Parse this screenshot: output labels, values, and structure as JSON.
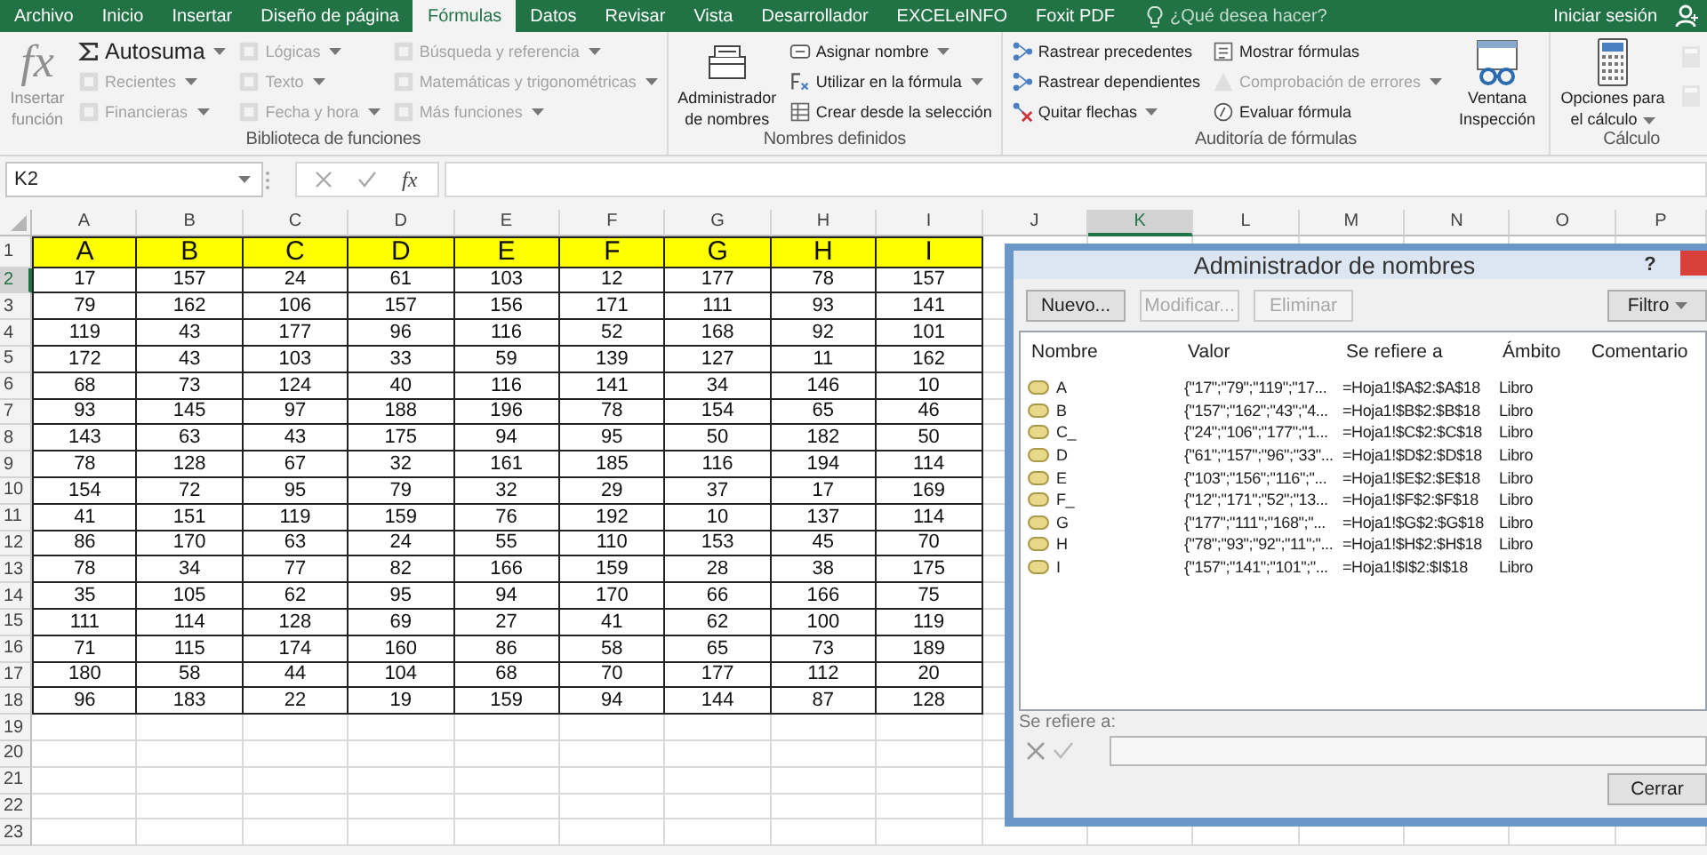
{
  "tabs": [
    {
      "label": "Archivo",
      "selected": false
    },
    {
      "label": "Inicio",
      "selected": false
    },
    {
      "label": "Insertar",
      "selected": false
    },
    {
      "label": "Diseño de página",
      "selected": false
    },
    {
      "label": "Fórmulas",
      "selected": true
    },
    {
      "label": "Datos",
      "selected": false
    },
    {
      "label": "Revisar",
      "selected": false
    },
    {
      "label": "Vista",
      "selected": false
    },
    {
      "label": "Desarrollador",
      "selected": false
    },
    {
      "label": "EXCELeINFO",
      "selected": false
    },
    {
      "label": "Foxit PDF",
      "selected": false
    }
  ],
  "tell_me": {
    "placeholder": "¿Qué desea hacer?"
  },
  "account": {
    "label": "Iniciar sesión"
  },
  "ribbon": {
    "groups": [
      {
        "title": "Biblioteca de funciones",
        "blocks": [
          {
            "kind": "big",
            "label": "Insertar función",
            "glyph": "fx",
            "disabled": true,
            "dropdown": false
          },
          {
            "kind": "column",
            "items": [
              {
                "label": "Autosuma",
                "disabled": false,
                "dropdown": true
              },
              {
                "label": "Recientes",
                "disabled": true,
                "dropdown": true
              },
              {
                "label": "Financieras",
                "disabled": true,
                "dropdown": true
              }
            ]
          },
          {
            "kind": "column",
            "items": [
              {
                "label": "Lógicas",
                "disabled": true,
                "dropdown": true
              },
              {
                "label": "Texto",
                "disabled": true,
                "dropdown": true
              },
              {
                "label": "Fecha y hora",
                "disabled": true,
                "dropdown": true
              }
            ]
          },
          {
            "kind": "column",
            "items": [
              {
                "label": "Búsqueda y referencia",
                "disabled": true,
                "dropdown": true
              },
              {
                "label": "Matemáticas y trigonométricas",
                "disabled": true,
                "dropdown": true
              },
              {
                "label": "Más funciones",
                "disabled": true,
                "dropdown": true
              }
            ]
          }
        ]
      },
      {
        "title": "Nombres definidos",
        "blocks": [
          {
            "kind": "big",
            "label": "Administrador de nombres",
            "disabled": false,
            "dropdown": false
          },
          {
            "kind": "column",
            "items": [
              {
                "label": "Asignar nombre",
                "disabled": false,
                "dropdown": true
              },
              {
                "label": "Utilizar en la fórmula",
                "disabled": false,
                "dropdown": true
              },
              {
                "label": "Crear desde la selección",
                "disabled": false,
                "dropdown": false
              }
            ]
          }
        ]
      },
      {
        "title": "Auditoría de fórmulas",
        "blocks": [
          {
            "kind": "column",
            "items": [
              {
                "label": "Rastrear precedentes",
                "disabled": false,
                "dropdown": false
              },
              {
                "label": "Rastrear dependientes",
                "disabled": false,
                "dropdown": false
              },
              {
                "label": "Quitar flechas",
                "disabled": false,
                "dropdown": true
              }
            ]
          },
          {
            "kind": "column",
            "items": [
              {
                "label": "Mostrar fórmulas",
                "disabled": false,
                "dropdown": false
              },
              {
                "label": "Comprobación de errores",
                "disabled": true,
                "dropdown": true
              },
              {
                "label": "Evaluar fórmula",
                "disabled": false,
                "dropdown": false
              }
            ]
          },
          {
            "kind": "big",
            "label": "Ventana Inspección",
            "disabled": false,
            "dropdown": false
          }
        ]
      },
      {
        "title": "Cálculo",
        "blocks": [
          {
            "kind": "big",
            "label": "Opciones para el cálculo",
            "disabled": false,
            "dropdown": true
          },
          {
            "kind": "icon_stack",
            "items": [
              {
                "disabled": true
              },
              {
                "disabled": true
              }
            ]
          }
        ]
      }
    ]
  },
  "formula_bar": {
    "name_box": "K2",
    "function_glyph": "fx"
  },
  "sheet": {
    "columns": [
      {
        "label": "A",
        "selected": false
      },
      {
        "label": "B",
        "selected": false
      },
      {
        "label": "C",
        "selected": false
      },
      {
        "label": "D",
        "selected": false
      },
      {
        "label": "E",
        "selected": false
      },
      {
        "label": "F",
        "selected": false
      },
      {
        "label": "G",
        "selected": false
      },
      {
        "label": "H",
        "selected": false
      },
      {
        "label": "I",
        "selected": false
      },
      {
        "label": "J",
        "selected": false
      },
      {
        "label": "K",
        "selected": true
      },
      {
        "label": "L",
        "selected": false
      },
      {
        "label": "M",
        "selected": false
      },
      {
        "label": "N",
        "selected": false
      },
      {
        "label": "O",
        "selected": false
      },
      {
        "label": "P",
        "selected": false
      }
    ],
    "rows": [
      {
        "number": "1",
        "selected": false,
        "kind": "header",
        "cells": [
          "A",
          "B",
          "C",
          "D",
          "E",
          "F",
          "G",
          "H",
          "I"
        ]
      },
      {
        "number": "2",
        "selected": true,
        "kind": "data",
        "cells": [
          "17",
          "157",
          "24",
          "61",
          "103",
          "12",
          "177",
          "78",
          "157"
        ]
      },
      {
        "number": "3",
        "selected": false,
        "kind": "data",
        "cells": [
          "79",
          "162",
          "106",
          "157",
          "156",
          "171",
          "111",
          "93",
          "141"
        ]
      },
      {
        "number": "4",
        "selected": false,
        "kind": "data",
        "cells": [
          "119",
          "43",
          "177",
          "96",
          "116",
          "52",
          "168",
          "92",
          "101"
        ]
      },
      {
        "number": "5",
        "selected": false,
        "kind": "data",
        "cells": [
          "172",
          "43",
          "103",
          "33",
          "59",
          "139",
          "127",
          "11",
          "162"
        ]
      },
      {
        "number": "6",
        "selected": false,
        "kind": "data",
        "cells": [
          "68",
          "73",
          "124",
          "40",
          "116",
          "141",
          "34",
          "146",
          "10"
        ]
      },
      {
        "number": "7",
        "selected": false,
        "kind": "data",
        "cells": [
          "93",
          "145",
          "97",
          "188",
          "196",
          "78",
          "154",
          "65",
          "46"
        ]
      },
      {
        "number": "8",
        "selected": false,
        "kind": "data",
        "cells": [
          "143",
          "63",
          "43",
          "175",
          "94",
          "95",
          "50",
          "182",
          "50"
        ]
      },
      {
        "number": "9",
        "selected": false,
        "kind": "data",
        "cells": [
          "78",
          "128",
          "67",
          "32",
          "161",
          "185",
          "116",
          "194",
          "114"
        ]
      },
      {
        "number": "10",
        "selected": false,
        "kind": "data",
        "cells": [
          "154",
          "72",
          "95",
          "79",
          "32",
          "29",
          "37",
          "17",
          "169"
        ]
      },
      {
        "number": "11",
        "selected": false,
        "kind": "data",
        "cells": [
          "41",
          "151",
          "119",
          "159",
          "76",
          "192",
          "10",
          "137",
          "114"
        ]
      },
      {
        "number": "12",
        "selected": false,
        "kind": "data",
        "cells": [
          "86",
          "170",
          "63",
          "24",
          "55",
          "110",
          "153",
          "45",
          "70"
        ]
      },
      {
        "number": "13",
        "selected": false,
        "kind": "data",
        "cells": [
          "78",
          "34",
          "77",
          "82",
          "166",
          "159",
          "28",
          "38",
          "175"
        ]
      },
      {
        "number": "14",
        "selected": false,
        "kind": "data",
        "cells": [
          "35",
          "105",
          "62",
          "95",
          "94",
          "170",
          "66",
          "166",
          "75"
        ]
      },
      {
        "number": "15",
        "selected": false,
        "kind": "data",
        "cells": [
          "111",
          "114",
          "128",
          "69",
          "27",
          "41",
          "62",
          "100",
          "119"
        ]
      },
      {
        "number": "16",
        "selected": false,
        "kind": "data",
        "cells": [
          "71",
          "115",
          "174",
          "160",
          "86",
          "58",
          "65",
          "73",
          "189"
        ]
      },
      {
        "number": "17",
        "selected": false,
        "kind": "data",
        "cells": [
          "180",
          "58",
          "44",
          "104",
          "68",
          "70",
          "177",
          "112",
          "20"
        ]
      },
      {
        "number": "18",
        "selected": false,
        "kind": "data",
        "cells": [
          "96",
          "183",
          "22",
          "19",
          "159",
          "94",
          "144",
          "87",
          "128"
        ]
      },
      {
        "number": "19",
        "selected": false,
        "kind": "empty"
      },
      {
        "number": "20",
        "selected": false,
        "kind": "empty"
      },
      {
        "number": "21",
        "selected": false,
        "kind": "empty"
      },
      {
        "number": "22",
        "selected": false,
        "kind": "empty"
      },
      {
        "number": "23",
        "selected": false,
        "kind": "empty"
      }
    ]
  },
  "dialog": {
    "title": "Administrador de nombres",
    "help": "?",
    "buttons": [
      {
        "label": "Nuevo...",
        "disabled": false
      },
      {
        "label": "Modificar...",
        "disabled": true
      },
      {
        "label": "Eliminar",
        "disabled": true
      }
    ],
    "filter_button": "Filtro",
    "columns": [
      "Nombre",
      "Valor",
      "Se refiere a",
      "Ámbito",
      "Comentario"
    ],
    "names": [
      {
        "name": "A",
        "value": "{\"17\";\"79\";\"119\";\"17...",
        "refers_to": "=Hoja1!$A$2:$A$18",
        "scope": "Libro"
      },
      {
        "name": "B",
        "value": "{\"157\";\"162\";\"43\";\"4...",
        "refers_to": "=Hoja1!$B$2:$B$18",
        "scope": "Libro"
      },
      {
        "name": "C_",
        "value": "{\"24\";\"106\";\"177\";\"1...",
        "refers_to": "=Hoja1!$C$2:$C$18",
        "scope": "Libro"
      },
      {
        "name": "D",
        "value": "{\"61\";\"157\";\"96\";\"33\"...",
        "refers_to": "=Hoja1!$D$2:$D$18",
        "scope": "Libro"
      },
      {
        "name": "E",
        "value": "{\"103\";\"156\";\"116\";\"...",
        "refers_to": "=Hoja1!$E$2:$E$18",
        "scope": "Libro"
      },
      {
        "name": "F_",
        "value": "{\"12\";\"171\";\"52\";\"13...",
        "refers_to": "=Hoja1!$F$2:$F$18",
        "scope": "Libro"
      },
      {
        "name": "G",
        "value": "{\"177\";\"111\";\"168\";\"...",
        "refers_to": "=Hoja1!$G$2:$G$18",
        "scope": "Libro"
      },
      {
        "name": "H",
        "value": "{\"78\";\"93\";\"92\";\"11\";\"...",
        "refers_to": "=Hoja1!$H$2:$H$18",
        "scope": "Libro"
      },
      {
        "name": "I",
        "value": "{\"157\";\"141\";\"101\";\"...",
        "refers_to": "=Hoja1!$I$2:$I$18",
        "scope": "Libro"
      }
    ],
    "refers_label": "Se refiere a:",
    "close_button": "Cerrar"
  }
}
